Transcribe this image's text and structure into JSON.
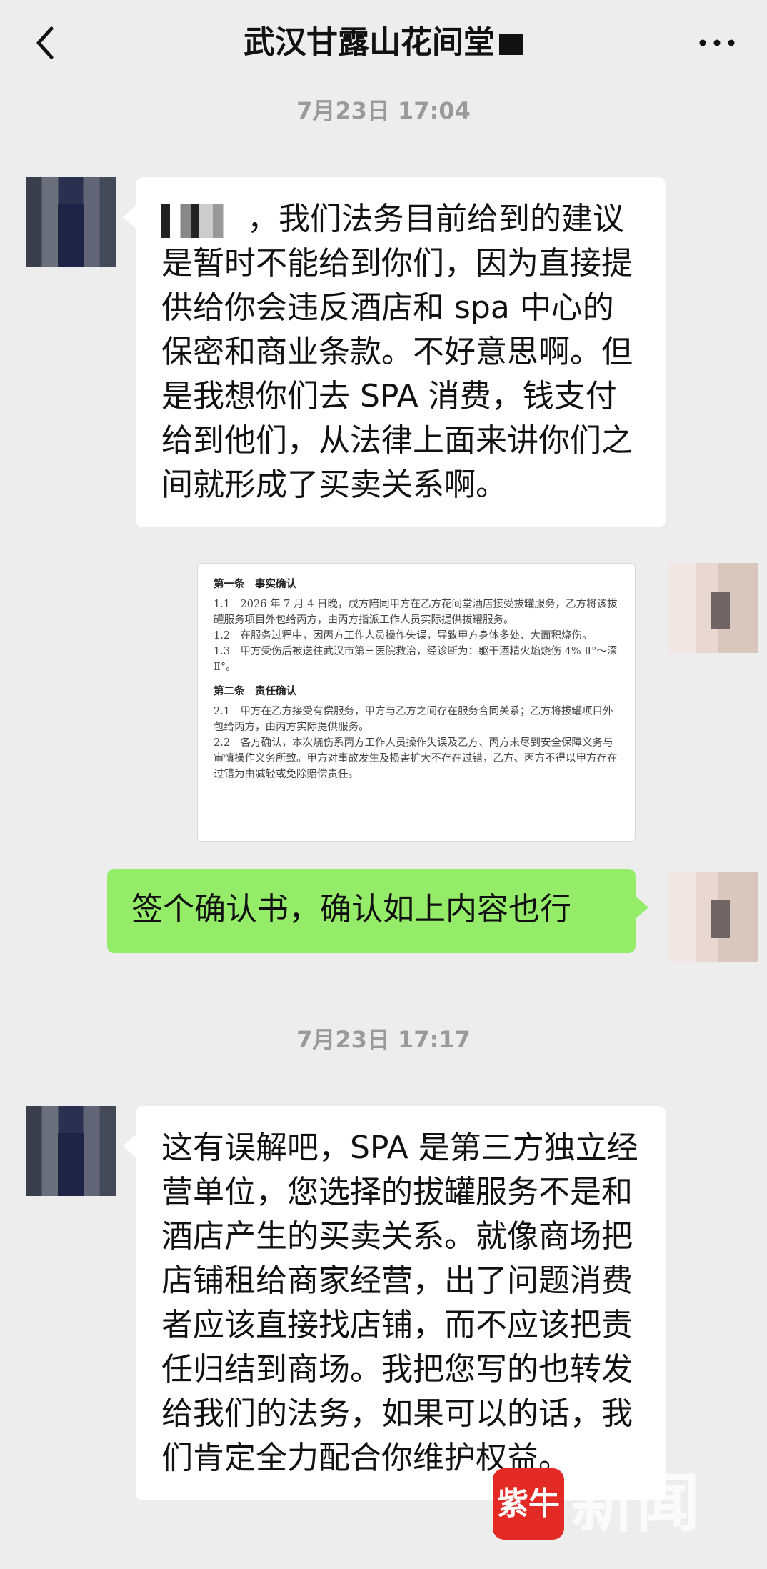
{
  "header": {
    "title": "武汉甘露山花间堂"
  },
  "messages": [
    {
      "timestamp": "7月23日 17:04"
    },
    {
      "bubble_text": "，我们法务目前给到的建议是暂时不能给到你们，因为直接提供给你会违反酒店和 spa 中心的保密和商业条款。不好意思啊。但是我想你们去 SPA 消费，钱支付给到他们，从法律上面来讲你们之间就形成了买卖关系啊。"
    },
    {
      "document": {
        "sections": [
          {
            "heading": "第一条　事实确认",
            "lines": [
              "1.1　2026 年 7 月 4 日晚，戊方陪同甲方在乙方花间堂酒店接受拔罐服务，乙方将该拔罐服务项目外包给丙方，由丙方指派工作人员实际提供拔罐服务。",
              "1.2　在服务过程中，因丙方工作人员操作失误，导致甲方身体多处、大面积烧伤。",
              "1.3　甲方受伤后被送往武汉市第三医院救治，经诊断为：躯干酒精火焰烧伤 4% Ⅱ°～深Ⅱ°。"
            ]
          },
          {
            "heading": "第二条　责任确认",
            "lines": [
              "2.1　甲方在乙方接受有偿服务，甲方与乙方之间存在服务合同关系；乙方将拔罐项目外包给丙方，由丙方实际提供服务。",
              "2.2　各方确认，本次烧伤系丙方工作人员操作失误及乙方、丙方未尽到安全保障义务与审慎操作义务所致。甲方对事故发生及损害扩大不存在过错，乙方、丙方不得以甲方存在过错为由减轻或免除赔偿责任。"
            ]
          }
        ]
      }
    },
    {
      "bubble_text": "签个确认书，确认如上内容也行"
    },
    {
      "timestamp": "7月23日 17:17"
    },
    {
      "bubble_text": "这有误解吧，SPA 是第三方独立经营单位，您选择的拔罐服务不是和酒店产生的买卖关系。就像商场把店铺租给商家经营，出了问题消费者应该直接找店铺，而不应该把责任归结到商场。我把您写的也转发给我们的法务，如果可以的话，我们肯定全力配合你维护权益。"
    }
  ],
  "watermark": {
    "logo_text": "紫牛",
    "text": "新闻"
  },
  "colors": {
    "background": "#ededed",
    "bubble_in": "#ffffff",
    "bubble_out": "#95ec69",
    "watermark_logo": "#e42a25"
  }
}
